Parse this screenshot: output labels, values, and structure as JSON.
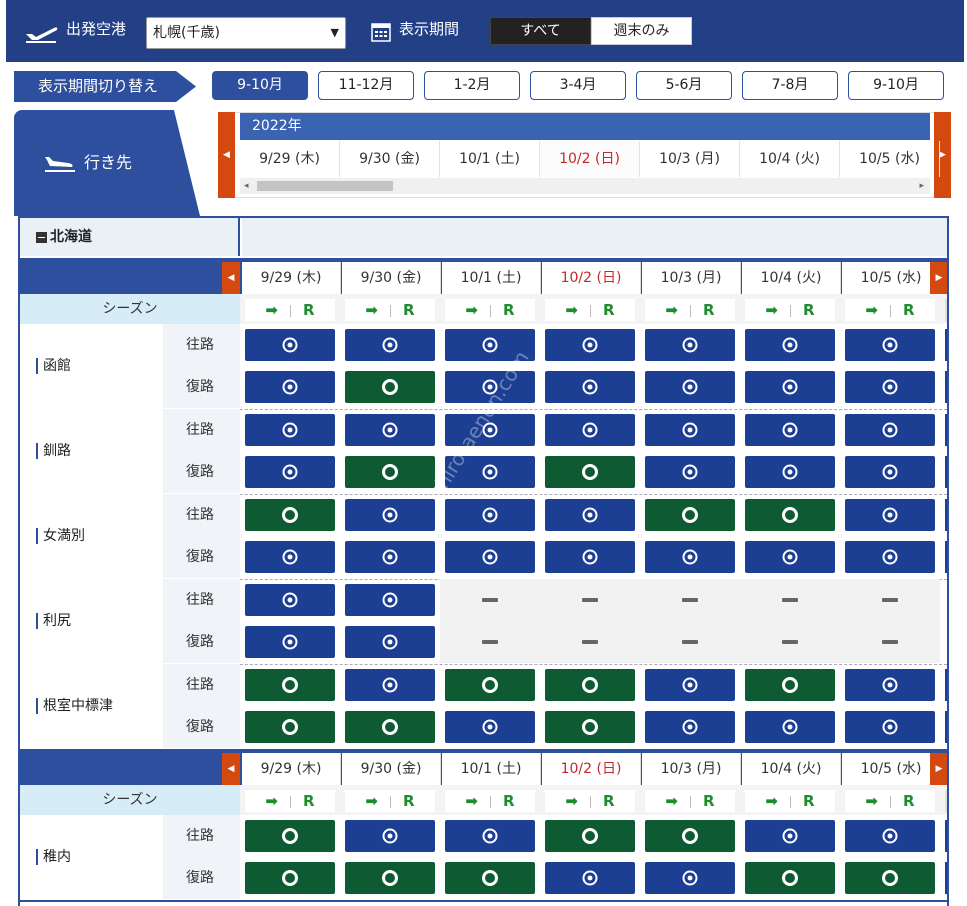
{
  "header": {
    "departure_label": "出発空港",
    "departure_value": "札幌(千歳)",
    "period_label": "表示期間",
    "filter_all": "すべて",
    "filter_weekend": "週末のみ"
  },
  "period_switch": {
    "label": "表示期間切り替え",
    "tabs": [
      "9-10月",
      "11-12月",
      "1-2月",
      "3-4月",
      "5-6月",
      "7-8月",
      "9-10月"
    ],
    "active_index": 0
  },
  "destination_label": "行き先",
  "year": "2022年",
  "dates": [
    {
      "label": "9/29 (木)",
      "holiday": false
    },
    {
      "label": "9/30 (金)",
      "holiday": false
    },
    {
      "label": "10/1 (土)",
      "holiday": false
    },
    {
      "label": "10/2 (日)",
      "holiday": true
    },
    {
      "label": "10/3 (月)",
      "holiday": false
    },
    {
      "label": "10/4 (火)",
      "holiday": false
    },
    {
      "label": "10/5 (水)",
      "holiday": false
    }
  ],
  "region": "北海道",
  "season_label": "シーズン",
  "season_symbol": "R",
  "direction_labels": {
    "outbound": "往路",
    "return": "復路"
  },
  "legend_statuses": {
    "blue": "dot-circle",
    "green": "open-circle",
    "none": "dash"
  },
  "colors": {
    "navy": "#2d4f9e",
    "cell_blue": "#1c3f93",
    "cell_green": "#0e5a33",
    "accent_orange": "#d4490f",
    "holiday_red": "#c62828"
  },
  "destinations": [
    {
      "name": "函館",
      "outbound": [
        "blue",
        "blue",
        "blue",
        "blue",
        "blue",
        "blue",
        "blue"
      ],
      "return": [
        "blue",
        "green",
        "blue",
        "blue",
        "blue",
        "blue",
        "blue"
      ]
    },
    {
      "name": "釧路",
      "outbound": [
        "blue",
        "blue",
        "blue",
        "blue",
        "blue",
        "blue",
        "blue"
      ],
      "return": [
        "blue",
        "green",
        "blue",
        "green",
        "blue",
        "blue",
        "blue"
      ]
    },
    {
      "name": "女満別",
      "outbound": [
        "green",
        "blue",
        "blue",
        "blue",
        "green",
        "green",
        "blue"
      ],
      "return": [
        "blue",
        "blue",
        "blue",
        "blue",
        "blue",
        "blue",
        "blue"
      ]
    },
    {
      "name": "利尻",
      "outbound": [
        "blue",
        "blue",
        "none",
        "none",
        "none",
        "none",
        "none"
      ],
      "return": [
        "blue",
        "blue",
        "none",
        "none",
        "none",
        "none",
        "none"
      ]
    },
    {
      "name": "根室中標津",
      "outbound": [
        "green",
        "blue",
        "green",
        "green",
        "blue",
        "green",
        "blue"
      ],
      "return": [
        "green",
        "green",
        "blue",
        "green",
        "blue",
        "blue",
        "blue"
      ]
    },
    {
      "name": "稚内",
      "outbound": [
        "green",
        "blue",
        "blue",
        "green",
        "green",
        "blue",
        "blue"
      ],
      "return": [
        "green",
        "green",
        "green",
        "blue",
        "blue",
        "green",
        "green"
      ]
    }
  ]
}
